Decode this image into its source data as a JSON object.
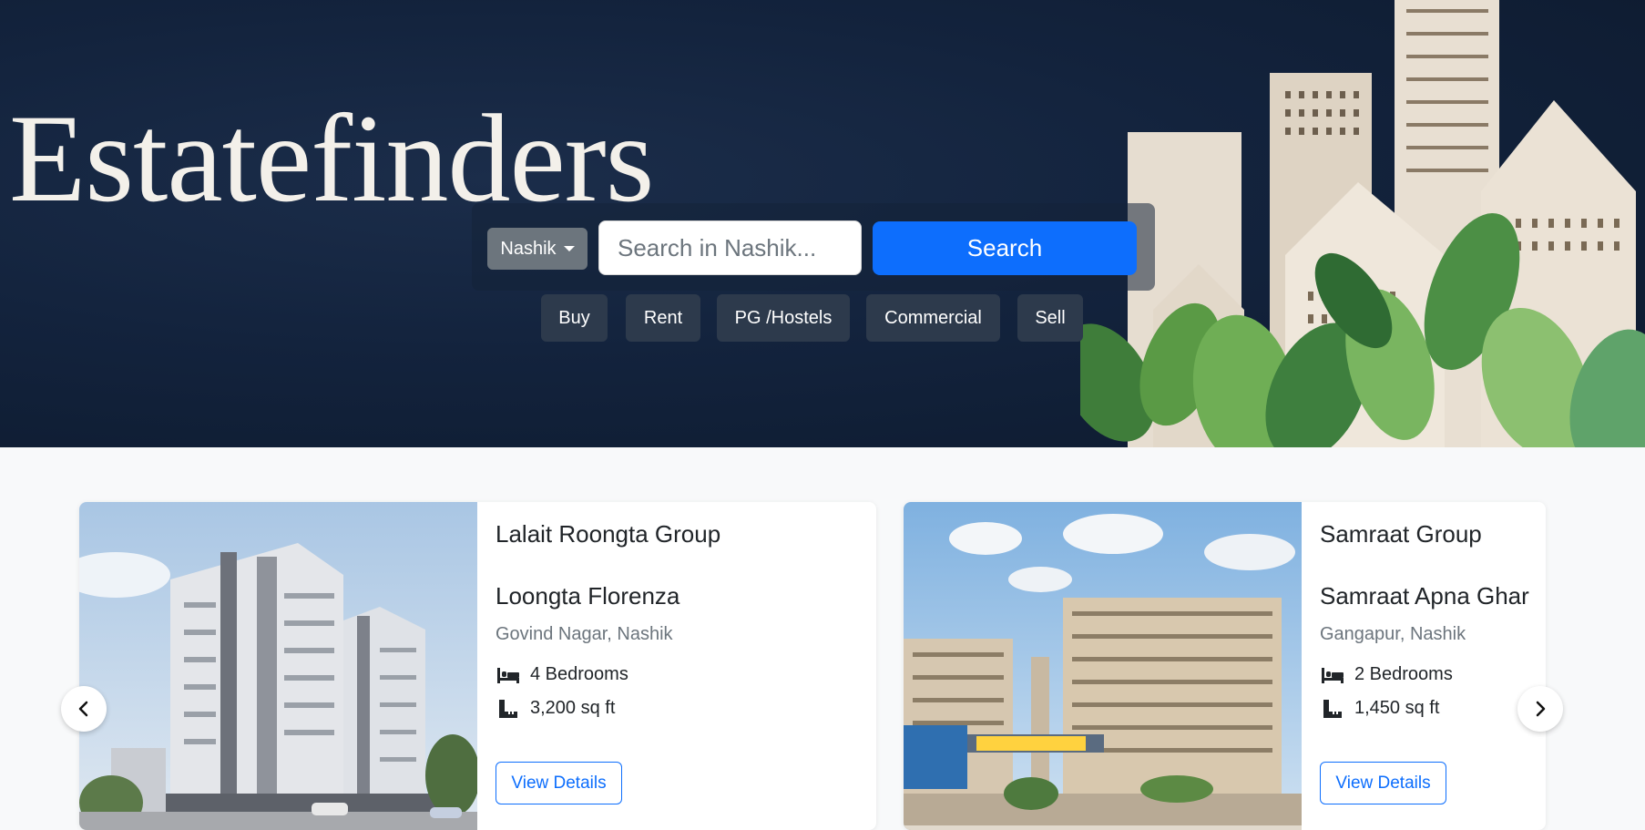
{
  "brand": "Estatefinders",
  "search": {
    "city": "Nashik",
    "placeholder": "Search in Nashik...",
    "button_label": "Search"
  },
  "categories": [
    {
      "label": "Buy"
    },
    {
      "label": "Rent"
    },
    {
      "label": "PG /Hostels"
    },
    {
      "label": "Commercial"
    },
    {
      "label": "Sell"
    }
  ],
  "listings": [
    {
      "builder": "Lalait Roongta Group",
      "project": "Loongta Florenza",
      "location": "Govind Nagar, Nashik",
      "bedrooms": "4 Bedrooms",
      "area": "3,200 sq ft",
      "button": "View Details"
    },
    {
      "builder": "Samraat Group",
      "project": "Samraat Apna Ghar",
      "location": "Gangapur, Nashik",
      "bedrooms": "2 Bedrooms",
      "area": "1,450 sq ft",
      "button": "View Details"
    }
  ],
  "colors": {
    "primary": "#0d6efd",
    "hero_bg": "#13233d",
    "category_bg": "#2d3a4c",
    "city_btn": "#6c757d"
  }
}
